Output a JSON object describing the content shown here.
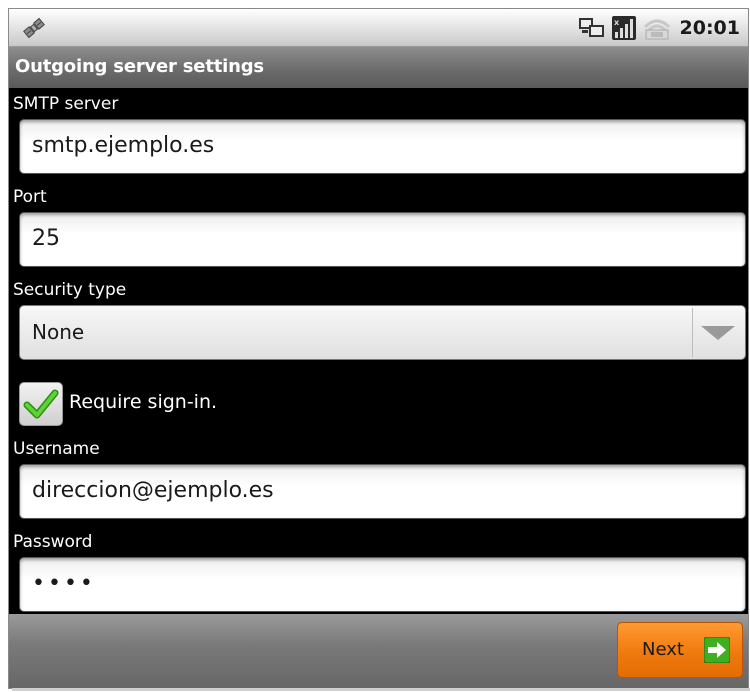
{
  "statusbar": {
    "left_icon": "satellite-icon",
    "icons": [
      "sync-icon",
      "signal-icon",
      "wifi-icon"
    ],
    "time": "20:01"
  },
  "title": "Outgoing server settings",
  "form": {
    "smtp_label": "SMTP server",
    "smtp_value": "smtp.ejemplo.es",
    "port_label": "Port",
    "port_value": "25",
    "security_label": "Security type",
    "security_value": "None",
    "require_signin_label": "Require sign-in.",
    "require_signin_checked": true,
    "username_label": "Username",
    "username_value": "direccion@ejemplo.es",
    "password_label": "Password",
    "password_value": "••••"
  },
  "actions": {
    "next_label": "Next"
  },
  "colors": {
    "accent": "#f07a0e",
    "background": "#000000",
    "titlebar": "#6c6c6c",
    "check": "#3fae1f"
  }
}
